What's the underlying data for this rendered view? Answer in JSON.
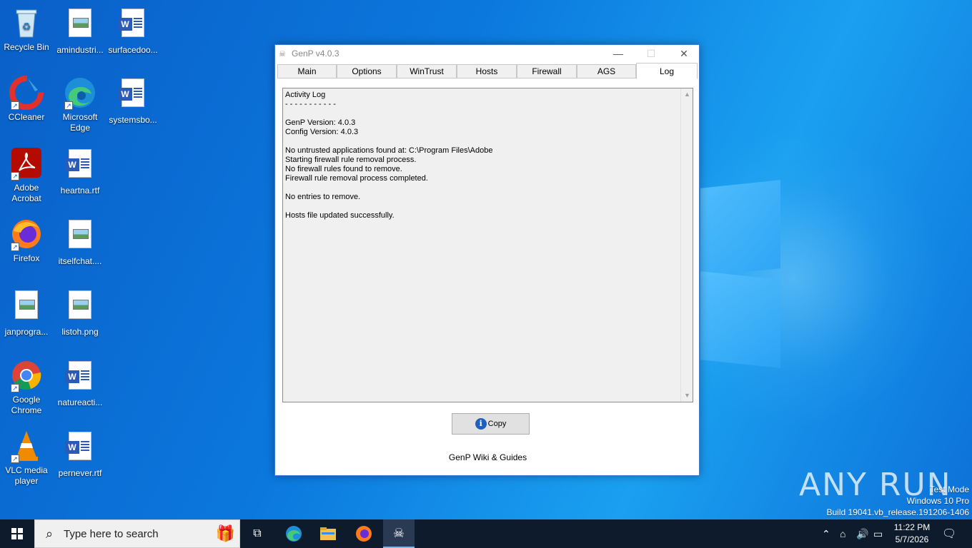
{
  "desktop": {
    "icons": [
      {
        "label": "Recycle Bin",
        "icon": "recycle-bin-icon"
      },
      {
        "label": "amindustri...",
        "icon": "image-file-icon"
      },
      {
        "label": "surfacedoo...",
        "icon": "word-file-icon"
      },
      {
        "label": "CCleaner",
        "icon": "ccleaner-icon"
      },
      {
        "label": "Microsoft Edge",
        "icon": "edge-icon"
      },
      {
        "label": "systemsbo...",
        "icon": "word-file-icon"
      },
      {
        "label": "Adobe Acrobat",
        "icon": "acrobat-icon"
      },
      {
        "label": "heartna.rtf",
        "icon": "word-file-icon"
      },
      {
        "label": "Firefox",
        "icon": "firefox-icon"
      },
      {
        "label": "itselfchat....",
        "icon": "image-file-icon"
      },
      {
        "label": "janprogra...",
        "icon": "image-file-icon"
      },
      {
        "label": "listoh.png",
        "icon": "image-file-icon"
      },
      {
        "label": "Google Chrome",
        "icon": "chrome-icon"
      },
      {
        "label": "natureacti...",
        "icon": "word-file-icon"
      },
      {
        "label": "VLC media player",
        "icon": "vlc-icon"
      },
      {
        "label": "pernever.rtf",
        "icon": "word-file-icon"
      }
    ]
  },
  "window": {
    "title": "GenP v4.0.3",
    "controls": {
      "minimize": "—",
      "maximize": "☐",
      "close": "✕"
    },
    "tabs": [
      "Main",
      "Options",
      "WinTrust",
      "Hosts",
      "Firewall",
      "AGS",
      "Log"
    ],
    "active_tab": "Log",
    "log_text": "Activity Log\n- - - - - - - - - - -\n\nGenP Version: 4.0.3\nConfig Version: 4.0.3\n\nNo untrusted applications found at: C:\\Program Files\\Adobe\nStarting firewall rule removal process.\nNo firewall rules found to remove.\nFirewall rule removal process completed.\n\nNo entries to remove.\n\nHosts file updated successfully.",
    "copy_button": "Copy",
    "wiki_link": "GenP Wiki & Guides"
  },
  "watermark": {
    "text": "ANY RUN",
    "test_mode": "Test Mode",
    "edition": "Windows 10 Pro",
    "build": "Build 19041.vb_release.191206-1406"
  },
  "taskbar": {
    "search_placeholder": "Type here to search",
    "clock_time": "11:22 PM",
    "clock_date": "5/7/2026"
  }
}
